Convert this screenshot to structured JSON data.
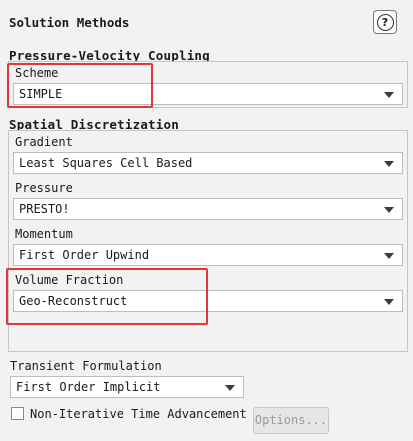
{
  "panel": {
    "title": "Solution Methods",
    "help_glyph": "?"
  },
  "pressure_velocity": {
    "group_title": "Pressure-Velocity Coupling",
    "scheme_label": "Scheme",
    "scheme_value": "SIMPLE"
  },
  "spatial": {
    "group_title": "Spatial Discretization",
    "gradient_label": "Gradient",
    "gradient_value": "Least Squares Cell Based",
    "pressure_label": "Pressure",
    "pressure_value": "PRESTO!",
    "momentum_label": "Momentum",
    "momentum_value": "First Order Upwind",
    "volume_fraction_label": "Volume Fraction",
    "volume_fraction_value": "Geo-Reconstruct"
  },
  "transient": {
    "label": "Transient Formulation",
    "value": "First Order Implicit"
  },
  "non_iterative": {
    "label": "Non-Iterative Time Advancement",
    "checked": false
  },
  "options_button": {
    "label": "Options..."
  },
  "colors": {
    "highlight": "#e23636",
    "background": "#f2f2f2"
  }
}
